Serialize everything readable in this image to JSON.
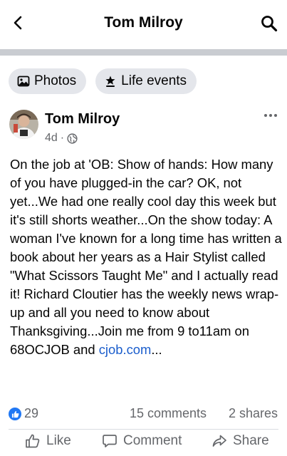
{
  "header": {
    "title": "Tom Milroy",
    "back_icon": "chevron-left-icon",
    "search_icon": "search-icon"
  },
  "chips": [
    {
      "label": "Photos",
      "icon": "photos-icon"
    },
    {
      "label": "Life events",
      "icon": "star-flag-icon"
    }
  ],
  "post": {
    "author": "Tom Milroy",
    "time": "4d",
    "separator": "·",
    "privacy_icon": "globe-icon",
    "text": "On the job at 'OB: Show of hands: How many of you have plugged-in the car? OK, not yet...We had one really cool day this week but it's still shorts weather...On the show today: A woman I've known for a long time has written a book about her years as a Hair Stylist called \"What Scissors Taught Me\" and I actually read it! Richard Cloutier has the weekly news wrap-up and all you need to know about Thanksgiving...Join me from 9 to11am on 68OCJOB and ",
    "link_text": "cjob.com",
    "ellipsis": "..."
  },
  "stats": {
    "reactions": "29",
    "comments": "15 comments",
    "shares": "2 shares"
  },
  "actions": {
    "like": "Like",
    "comment": "Comment",
    "share": "Share"
  },
  "colors": {
    "link": "#1a5dcc",
    "like_badge": "#2078f4",
    "chip_bg": "#e4e6eb",
    "secondary_text": "#65676b"
  }
}
